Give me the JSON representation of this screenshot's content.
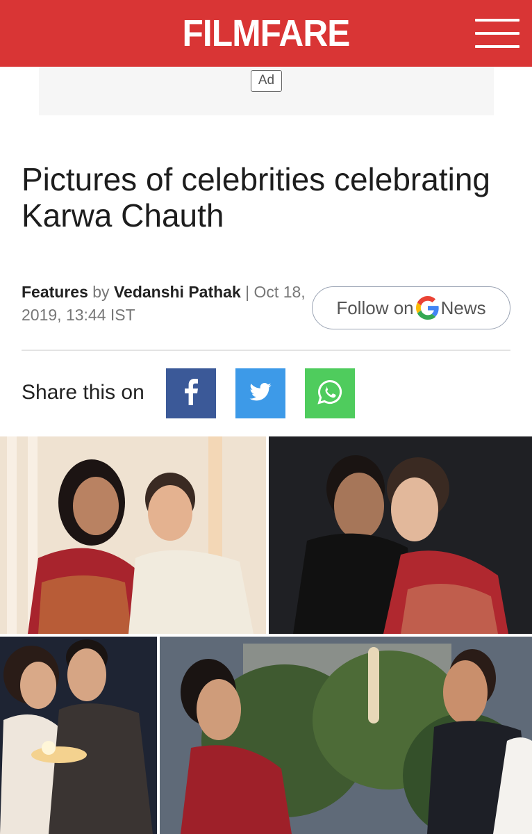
{
  "header": {
    "logo_text": "FILMFARE",
    "menu_icon": "hamburger-menu-icon",
    "brand_color": "#d93535"
  },
  "ad": {
    "label": "Ad"
  },
  "article": {
    "title": "Pictures of celebrities celebrating Karwa Chauth",
    "category": "Features",
    "by_word": "by",
    "author": "Vedanshi Pathak",
    "separator": "|",
    "date": "Oct 18, 2019, 13:44 IST"
  },
  "follow": {
    "prefix": "Follow on",
    "g_letter": "G",
    "suffix": "News",
    "icon": "google-g-icon"
  },
  "share": {
    "label": "Share this on",
    "buttons": [
      {
        "name": "facebook",
        "icon": "facebook-icon",
        "color": "#3b5998"
      },
      {
        "name": "twitter",
        "icon": "twitter-icon",
        "color": "#3d9ae8"
      },
      {
        "name": "whatsapp",
        "icon": "whatsapp-icon",
        "color": "#4fcc5d"
      }
    ]
  },
  "collage": {
    "photos": [
      {
        "name": "photo-couple-1"
      },
      {
        "name": "photo-couple-2"
      },
      {
        "name": "photo-couple-3"
      },
      {
        "name": "photo-couple-4"
      }
    ]
  }
}
